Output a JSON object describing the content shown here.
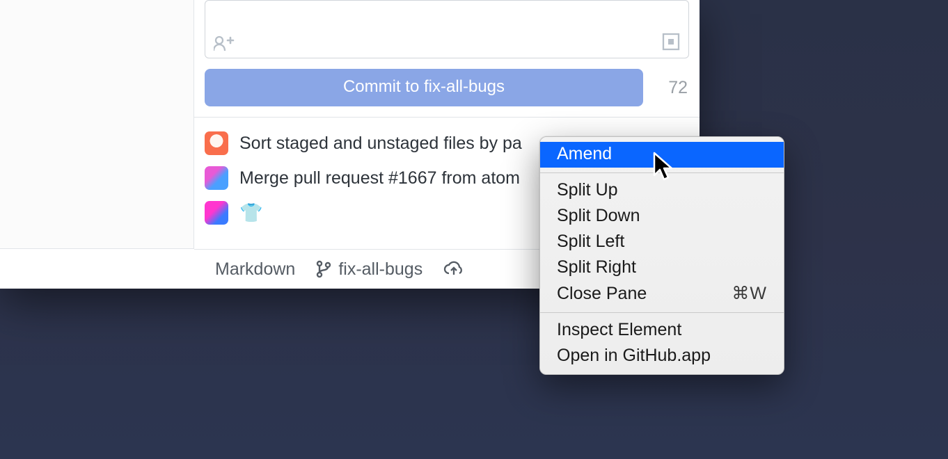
{
  "commit": {
    "button_label": "Commit to fix-all-bugs",
    "chars_remaining": "72"
  },
  "history": [
    {
      "avatar": "av1",
      "text": "Sort staged and unstaged files by pa"
    },
    {
      "avatar": "av2",
      "text": "Merge pull request #1667 from atom"
    },
    {
      "avatar": "av3",
      "emoji": "👕"
    }
  ],
  "status_bar": {
    "language": "Markdown",
    "branch": "fix-all-bugs"
  },
  "context_menu": {
    "groups": [
      [
        {
          "label": "Amend",
          "highlight": true
        }
      ],
      [
        {
          "label": "Split Up"
        },
        {
          "label": "Split Down"
        },
        {
          "label": "Split Left"
        },
        {
          "label": "Split Right"
        },
        {
          "label": "Close Pane",
          "shortcut": "⌘W"
        }
      ],
      [
        {
          "label": "Inspect Element"
        },
        {
          "label": "Open in GitHub.app"
        }
      ]
    ]
  }
}
